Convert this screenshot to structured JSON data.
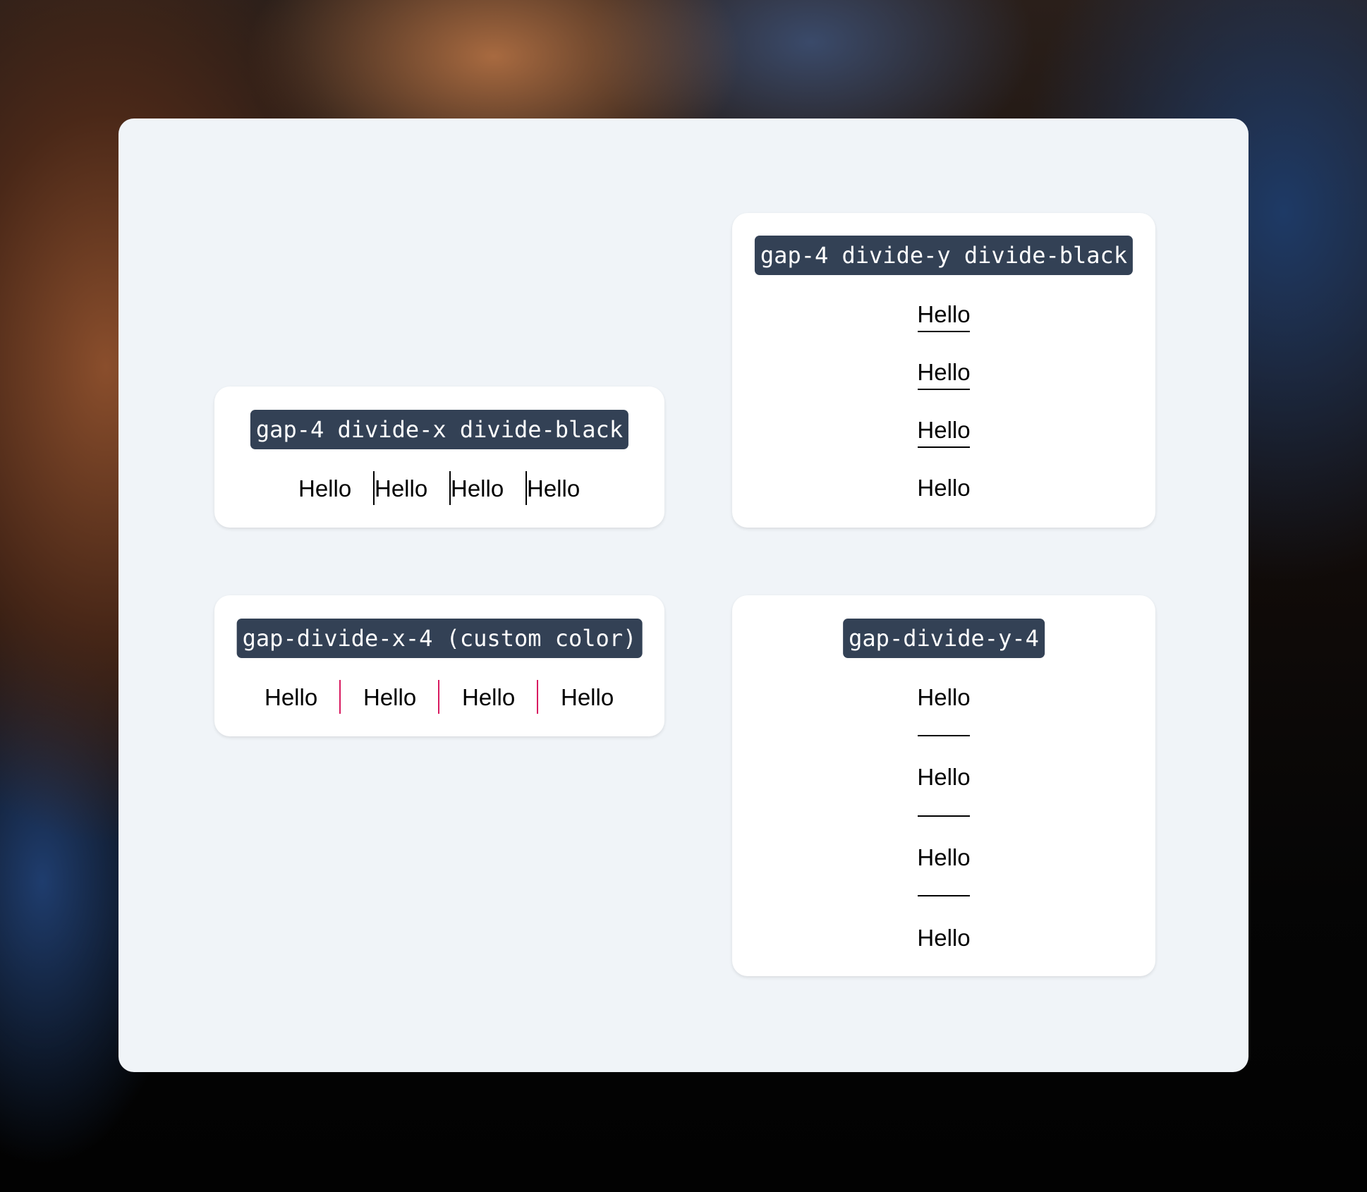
{
  "colors": {
    "panel_bg": "#f0f4f8",
    "card_bg": "#ffffff",
    "code_bg": "#334155",
    "divider_black": "#000000",
    "divider_custom": "#d81b60"
  },
  "cards": {
    "divide_x": {
      "label": "gap-4 divide-x divide-black",
      "items": [
        "Hello",
        "Hello",
        "Hello",
        "Hello"
      ]
    },
    "divide_y": {
      "label": "gap-4 divide-y divide-black",
      "items": [
        "Hello",
        "Hello",
        "Hello",
        "Hello"
      ]
    },
    "gap_divide_x": {
      "label": "gap-divide-x-4 (custom color)",
      "items": [
        "Hello",
        "Hello",
        "Hello",
        "Hello"
      ]
    },
    "gap_divide_y": {
      "label": "gap-divide-y-4",
      "items": [
        "Hello",
        "Hello",
        "Hello",
        "Hello"
      ]
    }
  }
}
